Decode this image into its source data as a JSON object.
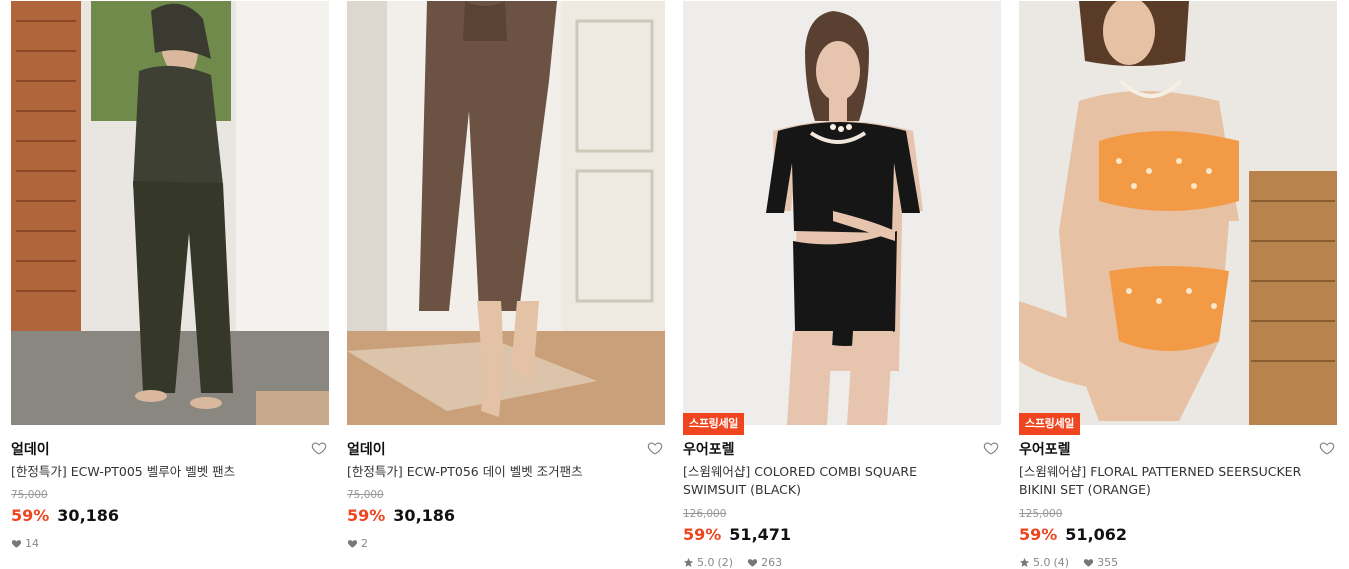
{
  "products": [
    {
      "brand": "얼데이",
      "name": "[한정특가] ECW-PT005 벨루아 벨벳 팬츠",
      "original_price": "75,000",
      "discount": "59%",
      "price": "30,186",
      "likes": "14",
      "badge": "",
      "rating": "",
      "reviews": ""
    },
    {
      "brand": "얼데이",
      "name": "[한정특가] ECW-PT056 데이 벨벳 조거팬츠",
      "original_price": "75,000",
      "discount": "59%",
      "price": "30,186",
      "likes": "2",
      "badge": "",
      "rating": "",
      "reviews": ""
    },
    {
      "brand": "우어포렐",
      "name": "[스윔웨어샵] COLORED COMBI SQUARE SWIMSUIT (BLACK)",
      "original_price": "126,000",
      "discount": "59%",
      "price": "51,471",
      "likes": "263",
      "badge": "스프링세일",
      "rating": "5.0",
      "reviews": "(2)"
    },
    {
      "brand": "우어포렐",
      "name": "[스윔웨어샵] FLORAL PATTERNED SEERSUCKER BIKINI SET (ORANGE)",
      "original_price": "125,000",
      "discount": "59%",
      "price": "51,062",
      "likes": "355",
      "badge": "스프링세일",
      "rating": "5.0",
      "reviews": "(4)"
    }
  ],
  "icons": {
    "wish": "heart-outline-icon",
    "like": "heart-filled-icon",
    "rating": "star-icon"
  },
  "colors": {
    "accent": "#f0451f",
    "muted": "#999999"
  }
}
